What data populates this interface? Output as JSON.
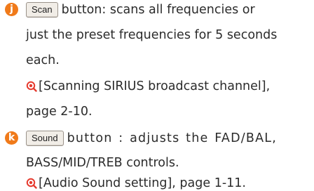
{
  "items": [
    {
      "marker": "j",
      "button_label": "Scan",
      "text_line1": "button: scans all frequencies or",
      "text_line2": "just the preset frequencies for 5 seconds",
      "text_line3": "each.",
      "ref_text": "[Scanning SIRIUS broadcast channel],",
      "ref_text2": "page 2-10."
    },
    {
      "marker": "k",
      "button_label": "Sound",
      "text_line1": "button : adjusts the FAD/BAL,",
      "text_line2": "BASS/MID/TREB controls.",
      "ref_text": "[Audio Sound setting], page 1-11."
    }
  ],
  "colors": {
    "marker": "#f07a1a",
    "ref_icon": "#e63a2e",
    "button_bg": "#f1ede7"
  },
  "icons": {
    "reference": "magnifier-ref-icon"
  }
}
